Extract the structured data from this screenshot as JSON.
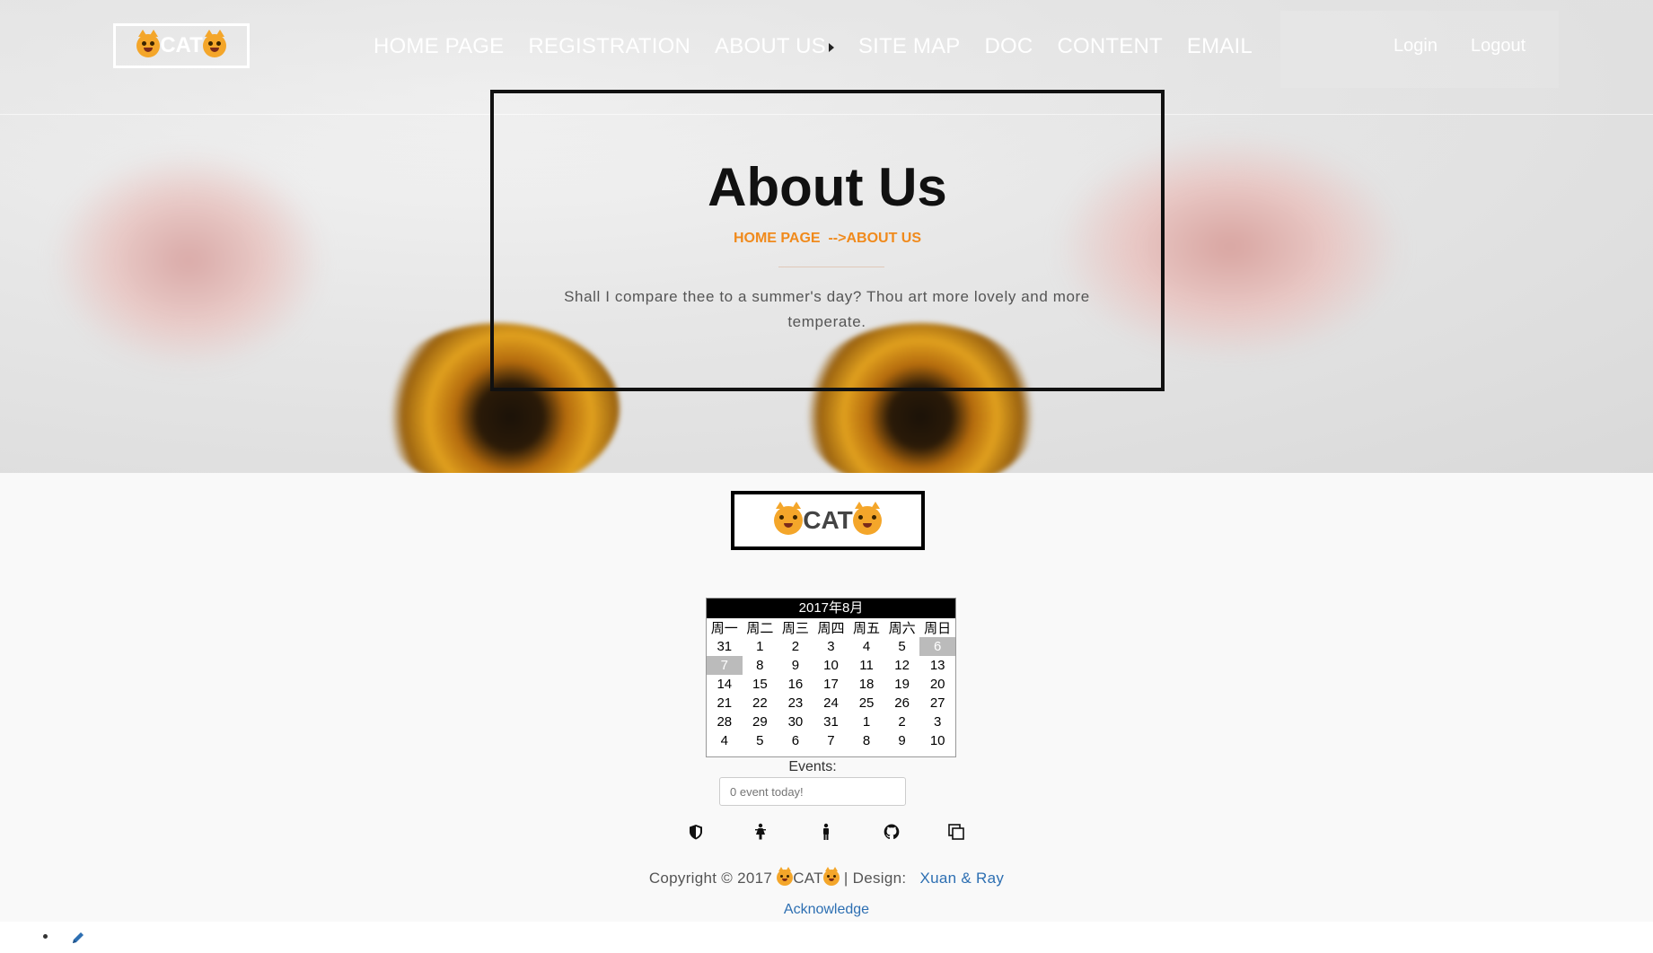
{
  "brand": {
    "name": "CAT"
  },
  "nav": {
    "items": [
      "HOME PAGE",
      "REGISTRATION",
      "ABOUT US",
      "SITE MAP",
      "DOC",
      "CONTENT",
      "EMAIL"
    ],
    "login": "Login",
    "logout": "Logout"
  },
  "hero": {
    "title": "About Us",
    "breadcrumb_home": "HOME PAGE",
    "breadcrumb_current": "-->ABOUT US",
    "quote": "Shall I compare thee to a summer's day? Thou art more lovely and more temperate."
  },
  "calendar": {
    "title": "2017年8月",
    "weekdays": [
      "周一",
      "周二",
      "周三",
      "周四",
      "周五",
      "周六",
      "周日"
    ],
    "weeks": [
      [
        "31",
        "1",
        "2",
        "3",
        "4",
        "5",
        "6"
      ],
      [
        "7",
        "8",
        "9",
        "10",
        "11",
        "12",
        "13"
      ],
      [
        "14",
        "15",
        "16",
        "17",
        "18",
        "19",
        "20"
      ],
      [
        "21",
        "22",
        "23",
        "24",
        "25",
        "26",
        "27"
      ],
      [
        "28",
        "29",
        "30",
        "31",
        "1",
        "2",
        "3"
      ],
      [
        "4",
        "5",
        "6",
        "7",
        "8",
        "9",
        "10"
      ]
    ],
    "highlighted": [
      "6",
      "7"
    ],
    "events_label": "Events:",
    "events_placeholder": "0 event today!"
  },
  "social": [
    "shield-icon",
    "female-icon",
    "male-icon",
    "github-icon",
    "copy-icon"
  ],
  "footer": {
    "copyright_prefix": "Copyright © 2017",
    "copyright_brand": "CAT",
    "design_label": "| Design:",
    "designers": "Xuan & Ray",
    "acknowledge": "Acknowledge"
  },
  "colors": {
    "accent": "#f08a1c",
    "link": "#2d6fb2"
  }
}
